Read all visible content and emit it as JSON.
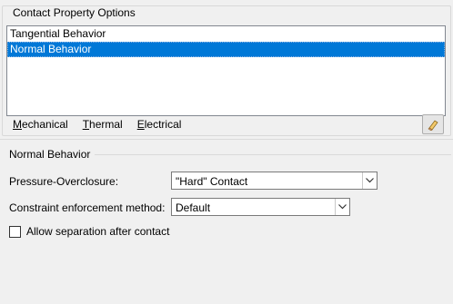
{
  "contact_property_options": {
    "title": "Contact Property Options",
    "items": [
      {
        "label": "Tangential Behavior",
        "selected": false
      },
      {
        "label": "Normal Behavior",
        "selected": true
      }
    ]
  },
  "menus": [
    {
      "label": "Mechanical",
      "mnemonic": "M"
    },
    {
      "label": "Thermal",
      "mnemonic": "T"
    },
    {
      "label": "Electrical",
      "mnemonic": "E"
    }
  ],
  "editor": {
    "section_title": "Normal Behavior",
    "pressure_overclosure": {
      "label": "Pressure-Overclosure:",
      "value": "\"Hard\" Contact"
    },
    "constraint_method": {
      "label": "Constraint enforcement method:",
      "value": "Default"
    },
    "allow_separation": {
      "label": "Allow separation after contact",
      "checked": false
    }
  },
  "colors": {
    "selection": "#0078d7",
    "background": "#f0f0f0"
  }
}
